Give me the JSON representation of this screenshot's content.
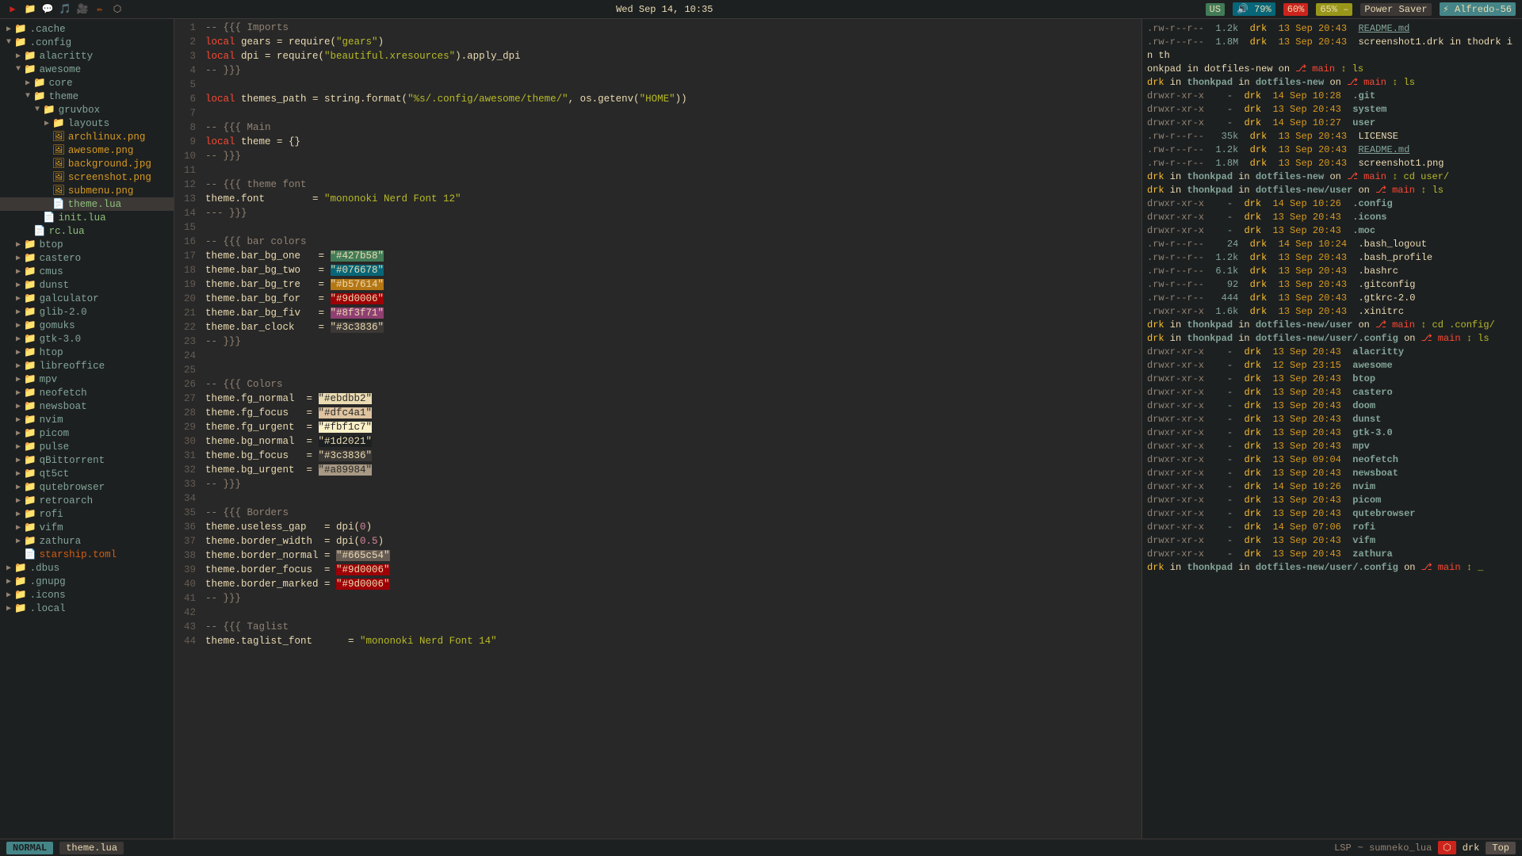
{
  "topbar": {
    "icons": [
      "▶",
      "📁",
      "💬",
      "🎵",
      "🎥",
      "✏",
      "⬡"
    ],
    "datetime": "Wed Sep 14, 10:35",
    "right_items": [
      {
        "label": "US",
        "class": "badge-us"
      },
      {
        "label": "🔊 79%",
        "class": "badge-vol"
      },
      {
        "label": "60%",
        "class": "badge-cpu"
      },
      {
        "label": "65% –",
        "class": "badge-bat"
      },
      {
        "label": "Power Saver",
        "class": "badge-power"
      },
      {
        "label": "⚡ Alfredo-56",
        "class": "badge-wifi"
      }
    ]
  },
  "sidebar": {
    "items": [
      {
        "indent": 1,
        "type": "dir",
        "open": true,
        "name": ".cache"
      },
      {
        "indent": 1,
        "type": "dir",
        "open": true,
        "name": ".config"
      },
      {
        "indent": 2,
        "type": "dir",
        "open": true,
        "name": "alacritty"
      },
      {
        "indent": 2,
        "type": "dir",
        "open": true,
        "name": "awesome"
      },
      {
        "indent": 3,
        "type": "dir",
        "open": true,
        "name": "core"
      },
      {
        "indent": 3,
        "type": "dir",
        "open": true,
        "name": "theme"
      },
      {
        "indent": 4,
        "type": "dir",
        "open": true,
        "name": "gruvbox"
      },
      {
        "indent": 5,
        "type": "dir",
        "open": true,
        "name": "layouts"
      },
      {
        "indent": 5,
        "type": "img",
        "name": "archlinux.png"
      },
      {
        "indent": 5,
        "type": "img",
        "name": "awesome.png"
      },
      {
        "indent": 5,
        "type": "img",
        "name": "background.jpg"
      },
      {
        "indent": 5,
        "type": "img",
        "name": "screenshot.png"
      },
      {
        "indent": 5,
        "type": "img",
        "name": "submenu.png"
      },
      {
        "indent": 5,
        "type": "lua",
        "name": "theme.lua",
        "active": true
      },
      {
        "indent": 4,
        "type": "lua",
        "name": "init.lua"
      },
      {
        "indent": 3,
        "type": "lua",
        "name": "rc.lua"
      },
      {
        "indent": 2,
        "type": "dir",
        "name": "btop"
      },
      {
        "indent": 2,
        "type": "dir",
        "name": "castero"
      },
      {
        "indent": 2,
        "type": "dir",
        "name": "cmus"
      },
      {
        "indent": 2,
        "type": "dir",
        "name": "dunst"
      },
      {
        "indent": 2,
        "type": "dir",
        "name": "galculator"
      },
      {
        "indent": 2,
        "type": "dir",
        "name": "glib-2.0"
      },
      {
        "indent": 2,
        "type": "dir",
        "name": "gomuks"
      },
      {
        "indent": 2,
        "type": "dir",
        "name": "gtk-3.0"
      },
      {
        "indent": 2,
        "type": "dir",
        "name": "htop"
      },
      {
        "indent": 2,
        "type": "dir",
        "name": "libreoffice"
      },
      {
        "indent": 2,
        "type": "dir",
        "name": "mpv"
      },
      {
        "indent": 2,
        "type": "dir",
        "name": "neofetch"
      },
      {
        "indent": 2,
        "type": "dir",
        "name": "newsboat"
      },
      {
        "indent": 2,
        "type": "dir",
        "name": "nvim"
      },
      {
        "indent": 2,
        "type": "dir",
        "name": "picom"
      },
      {
        "indent": 2,
        "type": "dir",
        "name": "pulse"
      },
      {
        "indent": 2,
        "type": "dir",
        "name": "qBittorrent"
      },
      {
        "indent": 2,
        "type": "dir",
        "name": "qt5ct"
      },
      {
        "indent": 2,
        "type": "dir",
        "name": "qutebrowser"
      },
      {
        "indent": 2,
        "type": "dir",
        "name": "retroarch"
      },
      {
        "indent": 2,
        "type": "dir",
        "name": "rofi"
      },
      {
        "indent": 2,
        "type": "dir",
        "name": "vifm"
      },
      {
        "indent": 2,
        "type": "dir",
        "name": "zathura"
      },
      {
        "indent": 2,
        "type": "toml",
        "name": "starship.toml"
      },
      {
        "indent": 1,
        "type": "dir",
        "name": ".dbus"
      },
      {
        "indent": 1,
        "type": "dir",
        "name": ".gnupg"
      },
      {
        "indent": 1,
        "type": "dir",
        "name": ".icons"
      },
      {
        "indent": 1,
        "type": "dir",
        "name": ".local"
      }
    ]
  },
  "editor": {
    "lines": [
      {
        "num": 1,
        "tokens": [
          {
            "t": "comment",
            "v": "-- {{{ Imports"
          }
        ]
      },
      {
        "num": 2,
        "tokens": [
          {
            "t": "kw",
            "v": "local"
          },
          {
            "t": "normal",
            "v": " gears = require("
          },
          {
            "t": "str",
            "v": "\"gears\""
          },
          {
            "t": "normal",
            "v": ")"
          }
        ]
      },
      {
        "num": 3,
        "tokens": [
          {
            "t": "kw",
            "v": "local"
          },
          {
            "t": "normal",
            "v": " dpi = require("
          },
          {
            "t": "str",
            "v": "\"beautiful.xresources\""
          },
          {
            "t": "normal",
            "v": ").apply_dpi"
          }
        ]
      },
      {
        "num": 4,
        "tokens": [
          {
            "t": "comment",
            "v": "-- }}}"
          }
        ]
      },
      {
        "num": 5,
        "tokens": []
      },
      {
        "num": 6,
        "tokens": [
          {
            "t": "kw",
            "v": "local"
          },
          {
            "t": "normal",
            "v": " themes_path = string.format("
          },
          {
            "t": "str",
            "v": "\"%s/.config/awesome/theme/\""
          },
          {
            "t": "normal",
            "v": ", os.getenv("
          },
          {
            "t": "str",
            "v": "\"HOME\""
          },
          {
            "t": "normal",
            "v": "))"
          }
        ]
      },
      {
        "num": 7,
        "tokens": []
      },
      {
        "num": 8,
        "tokens": [
          {
            "t": "comment",
            "v": "-- {{{ Main"
          }
        ]
      },
      {
        "num": 9,
        "tokens": [
          {
            "t": "kw",
            "v": "local"
          },
          {
            "t": "normal",
            "v": " theme = {}"
          }
        ]
      },
      {
        "num": 10,
        "tokens": [
          {
            "t": "comment",
            "v": "-- }}}"
          }
        ]
      },
      {
        "num": 11,
        "tokens": []
      },
      {
        "num": 12,
        "tokens": [
          {
            "t": "comment",
            "v": "-- {{{ theme font"
          }
        ]
      },
      {
        "num": 13,
        "tokens": [
          {
            "t": "normal",
            "v": "theme.font        = "
          },
          {
            "t": "str",
            "v": "\"mononoki Nerd Font 12\""
          }
        ]
      },
      {
        "num": 14,
        "tokens": [
          {
            "t": "comment",
            "v": "--- }}}"
          }
        ]
      },
      {
        "num": 15,
        "tokens": []
      },
      {
        "num": 16,
        "tokens": [
          {
            "t": "comment",
            "v": "-- {{{ bar colors"
          }
        ]
      },
      {
        "num": 17,
        "tokens": [
          {
            "t": "normal",
            "v": "theme.bar_bg_one   = "
          },
          {
            "t": "hl427b58",
            "v": "\"#427b58\""
          }
        ]
      },
      {
        "num": 18,
        "tokens": [
          {
            "t": "normal",
            "v": "theme.bar_bg_two   = "
          },
          {
            "t": "hl076678",
            "v": "\"#076678\""
          }
        ]
      },
      {
        "num": 19,
        "tokens": [
          {
            "t": "normal",
            "v": "theme.bar_bg_tre   = "
          },
          {
            "t": "hlb57614",
            "v": "\"#b57614\""
          }
        ]
      },
      {
        "num": 20,
        "tokens": [
          {
            "t": "normal",
            "v": "theme.bar_bg_for   = "
          },
          {
            "t": "hl9d0006",
            "v": "\"#9d0006\""
          }
        ]
      },
      {
        "num": 21,
        "tokens": [
          {
            "t": "normal",
            "v": "theme.bar_bg_fiv   = "
          },
          {
            "t": "hl8f3f71",
            "v": "\"#8f3f71\""
          }
        ]
      },
      {
        "num": 22,
        "tokens": [
          {
            "t": "normal",
            "v": "theme.bar_clock    = "
          },
          {
            "t": "hl3c3836",
            "v": "\"#3c3836\""
          }
        ]
      },
      {
        "num": 23,
        "tokens": [
          {
            "t": "comment",
            "v": "-- }}}"
          }
        ]
      },
      {
        "num": 24,
        "tokens": []
      },
      {
        "num": 25,
        "tokens": []
      },
      {
        "num": 26,
        "tokens": [
          {
            "t": "comment",
            "v": "-- {{{ Colors"
          }
        ]
      },
      {
        "num": 27,
        "tokens": [
          {
            "t": "normal",
            "v": "theme.fg_normal  = "
          },
          {
            "t": "hlebdbb2",
            "v": "\"#ebdbb2\""
          }
        ]
      },
      {
        "num": 28,
        "tokens": [
          {
            "t": "normal",
            "v": "theme.fg_focus   = "
          },
          {
            "t": "hldfc4a1",
            "v": "\"#dfc4a1\""
          }
        ]
      },
      {
        "num": 29,
        "tokens": [
          {
            "t": "normal",
            "v": "theme.fg_urgent  = "
          },
          {
            "t": "hlfbf1c7",
            "v": "\"#fbf1c7\""
          }
        ]
      },
      {
        "num": 30,
        "tokens": [
          {
            "t": "normal",
            "v": "theme.bg_normal  = "
          },
          {
            "t": "hl1d2021",
            "v": "\"#1d2021\""
          }
        ]
      },
      {
        "num": 31,
        "tokens": [
          {
            "t": "normal",
            "v": "theme.bg_focus   = "
          },
          {
            "t": "hl3c3836b",
            "v": "\"#3c3836\""
          }
        ]
      },
      {
        "num": 32,
        "tokens": [
          {
            "t": "normal",
            "v": "theme.bg_urgent  = "
          },
          {
            "t": "hla89984",
            "v": "\"#a89984\""
          }
        ]
      },
      {
        "num": 33,
        "tokens": [
          {
            "t": "comment",
            "v": "-- }}}"
          }
        ]
      },
      {
        "num": 34,
        "tokens": []
      },
      {
        "num": 35,
        "tokens": [
          {
            "t": "comment",
            "v": "-- {{{ Borders"
          }
        ]
      },
      {
        "num": 36,
        "tokens": [
          {
            "t": "normal",
            "v": "theme.useless_gap   = dpi("
          },
          {
            "t": "num",
            "v": "0"
          },
          {
            "t": "normal",
            "v": ")"
          }
        ]
      },
      {
        "num": 37,
        "tokens": [
          {
            "t": "normal",
            "v": "theme.border_width  = dpi("
          },
          {
            "t": "num",
            "v": "0.5"
          },
          {
            "t": "normal",
            "v": ")"
          }
        ]
      },
      {
        "num": 38,
        "tokens": [
          {
            "t": "normal",
            "v": "theme.border_normal = "
          },
          {
            "t": "hl665c54",
            "v": "\"#665c54\""
          }
        ]
      },
      {
        "num": 39,
        "tokens": [
          {
            "t": "normal",
            "v": "theme.border_focus  = "
          },
          {
            "t": "hl9d0006b",
            "v": "\"#9d0006\""
          }
        ]
      },
      {
        "num": 40,
        "tokens": [
          {
            "t": "normal",
            "v": "theme.border_marked = "
          },
          {
            "t": "hl9d0006c",
            "v": "\"#9d0006\""
          }
        ]
      },
      {
        "num": 41,
        "tokens": [
          {
            "t": "comment",
            "v": "-- }}}"
          }
        ]
      },
      {
        "num": 42,
        "tokens": []
      },
      {
        "num": 43,
        "tokens": [
          {
            "t": "comment",
            "v": "-- {{{ Taglist"
          }
        ]
      },
      {
        "num": 44,
        "tokens": [
          {
            "t": "normal",
            "v": "theme.taglist_font      = "
          },
          {
            "t": "str",
            "v": "\"mononoki Nerd Font 14\""
          }
        ]
      }
    ]
  },
  "terminal": {
    "lines": [
      ".rw-r--r--  1.2k  drk  13 Sep 20:43  README.md",
      ".rw-r--r--  1.8M  drk  13 Sep 20:43  screenshot1.drk in thodrk in th",
      "onkpad in dotfiles-new on ⎇ main ↕ ls",
      "drk in thonkpad in dotfiles-new on ⎇ main ↕ ls",
      "drwxr-xr-x    -  drk  14 Sep 10:28  .git",
      "drwxr-xr-x    -  drk  13 Sep 20:43  system",
      "drwxr-xr-x    -  drk  14 Sep 10:27  user",
      ".rw-r--r--   35k  drk  13 Sep 20:43  LICENSE",
      ".rw-r--r--  1.2k  drk  13 Sep 20:43  README.md",
      ".rw-r--r--  1.8M  drk  13 Sep 20:43  screenshot1.png",
      "drk in thonkpad in dotfiles-new on ⎇ main ↕ cd user/",
      "drk in thonkpad in dotfiles-new/user on ⎇ main ↕ ls",
      "drwxr-xr-x    -  drk  14 Sep 10:26  .config",
      "drwxr-xr-x    -  drk  13 Sep 20:43  .icons",
      "drwxr-xr-x    -  drk  13 Sep 20:43  .moc",
      ".rw-r--r--   24  drk  14 Sep 10:24  .bash_logout",
      ".rw-r--r--  1.2k  drk  13 Sep 20:43  .bash_profile",
      ".rw-r--r--  6.1k  drk  13 Sep 20:43  .bashrc",
      ".rw-r--r--   92  drk  13 Sep 20:43  .gitconfig",
      ".rw-r--r--  444  drk  13 Sep 20:43  .gtkrc-2.0",
      ".rwxr-xr-x  1.6k  drk  13 Sep 20:43  .xinitrc",
      "drk in thonkpad in dotfiles-new/user on ⎇ main ↕ cd .config/",
      "drk in thonkpad in dotfiles-new/user/.config on ⎇ main ↕ ls",
      "drwxr-xr-x    -  drk  13 Sep 20:43  alacritty",
      "drwxr-xr-x    -  drk  12 Sep 23:15  awesome",
      "drwxr-xr-x    -  drk  13 Sep 20:43  btop",
      "drwxr-xr-x    -  drk  13 Sep 20:43  castero",
      "drwxr-xr-x    -  drk  13 Sep 20:43  doom",
      "drwxr-xr-x    -  drk  13 Sep 20:43  dunst",
      "drwxr-xr-x    -  drk  13 Sep 20:43  gtk-3.0",
      "drwxr-xr-x    -  drk  13 Sep 20:43  mpv",
      "drwxr-xr-x    -  drk  13 Sep 09:04  neofetch",
      "drwxr-xr-x    -  drk  13 Sep 20:43  newsboat",
      "drwxr-xr-x    -  drk  14 Sep 10:26  nvim",
      "drwxr-xr-x    -  drk  13 Sep 20:43  picom",
      "drwxr-xr-x    -  drk  13 Sep 20:43  qutebrowser",
      "drwxr-xr-x    -  drk  14 Sep 07:06  rofi",
      "drwxr-xr-x    -  drk  13 Sep 20:43  vifm",
      "drwxr-xr-x    -  drk  13 Sep 20:43  zathura",
      "drk in thonkpad in dotfiles-new/user/.config on ⎇ main ↕ _"
    ]
  },
  "statusbar": {
    "mode": "NORMAL",
    "file": "theme.lua",
    "lsp": "LSP",
    "lsp_info": "~ sumneko_lua",
    "git_icon": "⬡",
    "git_branch": "drk",
    "top_label": "Top"
  }
}
